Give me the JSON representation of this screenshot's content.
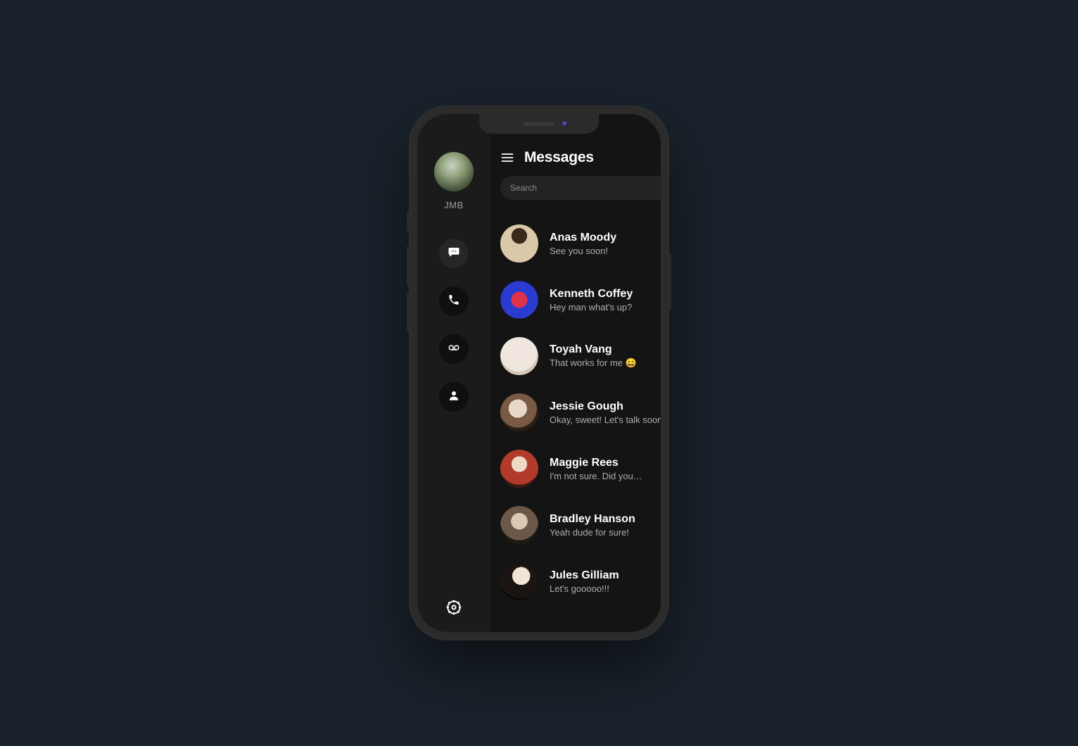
{
  "sidebar": {
    "profile_name": "JMB"
  },
  "header": {
    "title": "Messages"
  },
  "search": {
    "placeholder": "Search"
  },
  "conversations": [
    {
      "name": "Anas Moody",
      "preview": "See you soon!"
    },
    {
      "name": "Kenneth Coffey",
      "preview": "Hey man what's up?"
    },
    {
      "name": "Toyah Vang",
      "preview": "That works for me 😄"
    },
    {
      "name": "Jessie Gough",
      "preview": "Okay, sweet! Let's talk soon"
    },
    {
      "name": "Maggie Rees",
      "preview": "I'm not sure. Did you…"
    },
    {
      "name": "Bradley Hanson",
      "preview": "Yeah dude for sure!"
    },
    {
      "name": "Jules Gilliam",
      "preview": "Let's gooooo!!!"
    }
  ]
}
